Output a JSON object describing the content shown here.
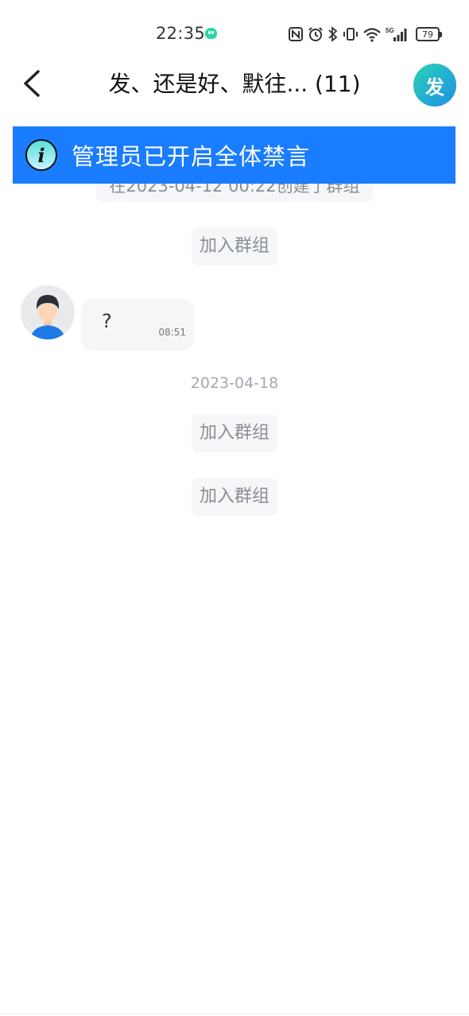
{
  "status_bar": {
    "time": "22:35",
    "network_label": "5G",
    "battery": "79"
  },
  "header": {
    "title": "发、还是好、默往... (11)",
    "publish_label": "发",
    "back_icon": "chevron-left-icon"
  },
  "banner": {
    "icon": "info-icon",
    "text": "管理员已开启全体禁言",
    "color": "#1a7cff"
  },
  "messages": {
    "created_notice": "在2023-04-12 00:22创建了群组",
    "join_1": "加入群组",
    "chat_message_text": "?",
    "chat_message_time": "08:51",
    "date_separator": "2023-04-18",
    "join_2": "加入群组",
    "join_3": "加入群组"
  }
}
